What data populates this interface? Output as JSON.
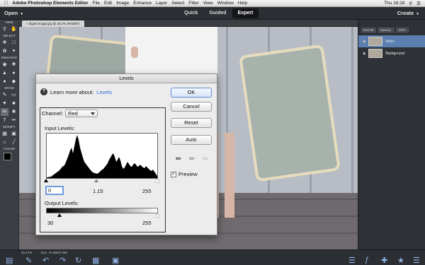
{
  "menubar": {
    "app_name": "Adobe Photoshop Elements Editor",
    "items": [
      "File",
      "Edit",
      "Image",
      "Enhance",
      "Layer",
      "Select",
      "Filter",
      "View",
      "Window",
      "Help"
    ],
    "clock": "Thu 16:18"
  },
  "topbar": {
    "open_label": "Open",
    "modes": [
      "Quick",
      "Guided",
      "Expert"
    ],
    "active_mode": "Expert",
    "create_label": "Create"
  },
  "toolbar": {
    "sections": [
      "VIEW",
      "SELECT",
      "ENHANCE",
      "DRAW",
      "MODIFY",
      "COLOR"
    ]
  },
  "document": {
    "tab_label": "digital image.jpg @ 26.2% (RGB/8*)"
  },
  "layers_panel": {
    "blend_mode": "Normal",
    "opacity_label": "Opacity:",
    "opacity_value": "100%",
    "layers": [
      {
        "name": "Retro",
        "selected": true
      },
      {
        "name": "Background",
        "selected": false
      }
    ]
  },
  "statusbar": {
    "zoom": "26.17%",
    "docinfo": "Doc: 47.5M/47.5M"
  },
  "levels_dialog": {
    "title": "Levels",
    "learn_prefix": "Learn more about:",
    "learn_link": "Levels",
    "buttons": {
      "ok": "OK",
      "cancel": "Cancel",
      "reset": "Reset",
      "auto": "Auto"
    },
    "channel_label": "Channel:",
    "channel_value": "Red",
    "input_label": "Input Levels:",
    "input_black": "0",
    "input_gamma": "1.15",
    "input_white": "255",
    "output_label": "Output Levels:",
    "output_black": "30",
    "output_white": "255",
    "preview_label": "Preview",
    "preview_checked": true
  },
  "colors": {
    "accent": "#2a6bd0",
    "layer_selected": "#5a7fb0"
  }
}
